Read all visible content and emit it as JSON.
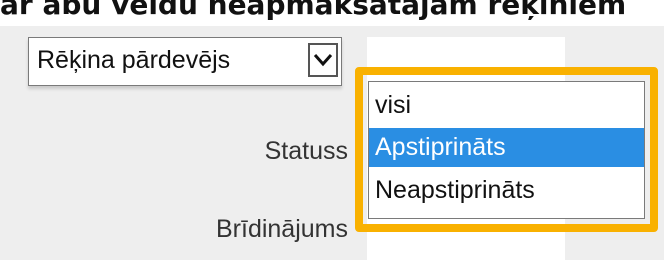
{
  "heading": "ar abu veidu neapmaksātajām rēķiniem",
  "select": {
    "value": "Rēķina pārdevējs",
    "arrow_icon": "chevron-down-icon"
  },
  "labels": {
    "status": "Statuss",
    "warning": "Brīdinājums"
  },
  "dropdown": {
    "options": [
      "visi",
      "Apstiprināts",
      "Neapstiprināts"
    ],
    "selected": "Apstiprināts"
  },
  "colors": {
    "highlight_border": "#f9b100",
    "selected_option_bg": "#2a8ee3",
    "panel_bg": "#eeeeee"
  }
}
